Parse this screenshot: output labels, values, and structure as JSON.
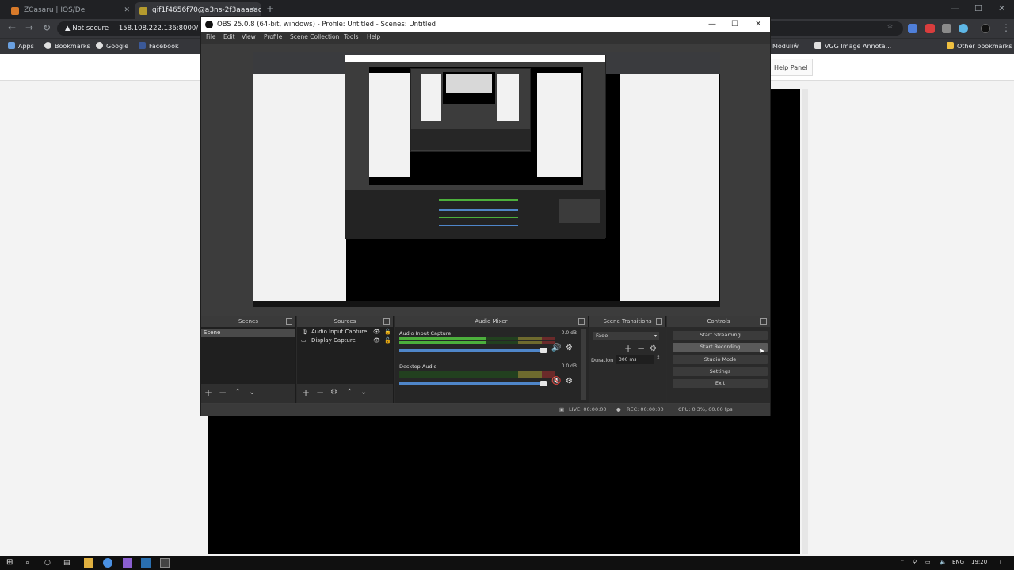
{
  "browser": {
    "tabs": [
      {
        "label": "ZCasaru | IOS/Del",
        "color": "#d87a2a"
      },
      {
        "label": "gif1f4656f70@a3ns-2f3aaaaao",
        "color": "#b59b2e"
      }
    ],
    "address": {
      "security": "Not secure",
      "url": "158.108.222.136:8000/"
    },
    "bookmarks": [
      {
        "label": "Apps",
        "color": "#6aa0e0"
      },
      {
        "label": "Bookmarks",
        "color": "#e0e0e0"
      },
      {
        "label": "Google",
        "color": "#e0e0e0"
      },
      {
        "label": "Facebook",
        "color": "#3b5998"
      },
      {
        "label": "Moduliŵ",
        "color": "#e0c060"
      },
      {
        "label": "VGG Image Annota...",
        "color": "#e0e0e0"
      },
      {
        "label": "Other bookmarks",
        "color": "#f0c040"
      }
    ],
    "page_button": "Help Panel"
  },
  "obs": {
    "title": "OBS 25.0.8 (64-bit, windows) - Profile: Untitled - Scenes: Untitled",
    "menu": [
      "File",
      "Edit",
      "View",
      "Profile",
      "Scene Collection",
      "Tools",
      "Help"
    ],
    "docks": {
      "scenes": {
        "title": "Scenes",
        "items": [
          "Scene"
        ]
      },
      "sources": {
        "title": "Sources",
        "items": [
          "Audio Input Capture",
          "Display Capture"
        ]
      },
      "mixer": {
        "title": "Audio Mixer",
        "channels": [
          {
            "name": "Audio Input Capture",
            "db": "-0.0 dB",
            "level": 0.56
          },
          {
            "name": "Desktop Audio",
            "db": "0.0 dB",
            "level": 0.0
          }
        ]
      },
      "transitions": {
        "title": "Scene Transitions",
        "selected": "Fade",
        "duration_label": "Duration",
        "duration_value": "300 ms"
      },
      "controls": {
        "title": "Controls",
        "buttons": [
          "Start Streaming",
          "Start Recording",
          "Studio Mode",
          "Settings",
          "Exit"
        ]
      }
    },
    "status": {
      "live": "LIVE: 00:00:00",
      "rec": "REC: 00:00:00",
      "cpu": "CPU: 0.3%, 60.00 fps"
    }
  },
  "taskbar": {
    "lang": "ENG",
    "time": "19:20"
  },
  "colors": {
    "chrome_dark": "#202124",
    "chrome_toolbar": "#35363a",
    "obs_bg": "#3c3c3c",
    "meter_green": "#4caf3c",
    "fader_blue": "#4f86c9"
  }
}
